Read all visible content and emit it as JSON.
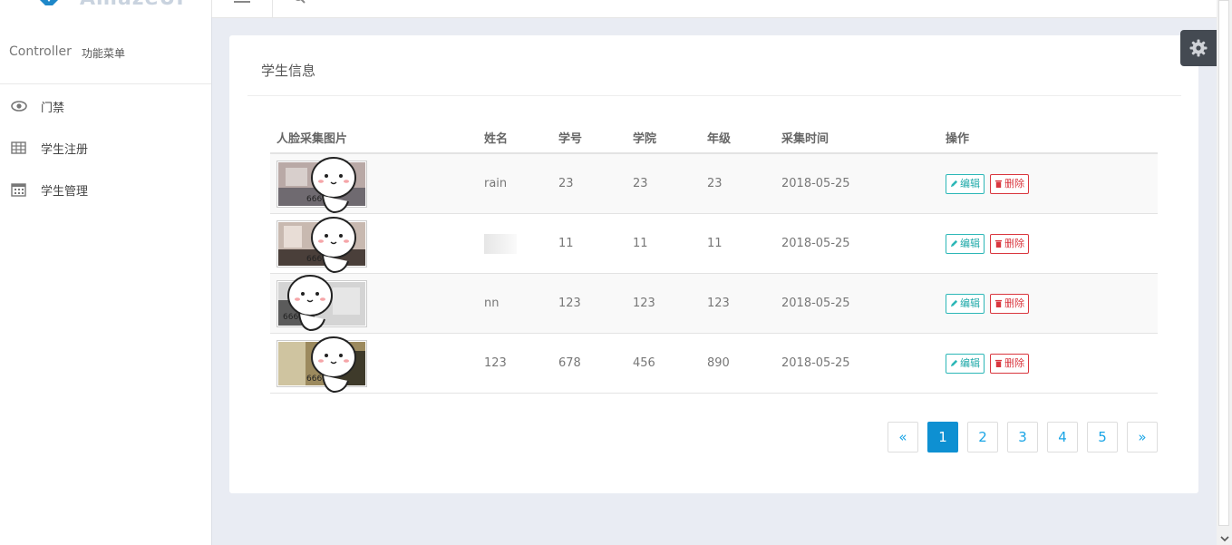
{
  "sidebar": {
    "title": "Controller",
    "subtitle": "功能菜单",
    "items": [
      {
        "label": "门禁",
        "icon": "eye-icon"
      },
      {
        "label": "学生注册",
        "icon": "table-icon"
      },
      {
        "label": "学生管理",
        "icon": "calendar-icon"
      }
    ]
  },
  "card": {
    "title": "学生信息"
  },
  "table": {
    "headers": [
      "人脸采集图片",
      "姓名",
      "学号",
      "学院",
      "年级",
      "采集时间",
      "操作"
    ],
    "rows": [
      {
        "name": "rain",
        "id": "23",
        "college": "23",
        "grade": "23",
        "time": "2018-05-25"
      },
      {
        "name": "",
        "id": "11",
        "college": "11",
        "grade": "11",
        "time": "2018-05-25"
      },
      {
        "name": "nn",
        "id": "123",
        "college": "123",
        "grade": "123",
        "time": "2018-05-25"
      },
      {
        "name": "123",
        "id": "678",
        "college": "456",
        "grade": "890",
        "time": "2018-05-25"
      }
    ],
    "edit_label": "编辑",
    "delete_label": "删除"
  },
  "pagination": {
    "prev": "«",
    "pages": [
      "1",
      "2",
      "3",
      "4",
      "5"
    ],
    "next": "»",
    "active": "1"
  },
  "colors": {
    "accent": "#0e90d2",
    "edit": "#2cb7b7",
    "delete": "#d9363e"
  }
}
